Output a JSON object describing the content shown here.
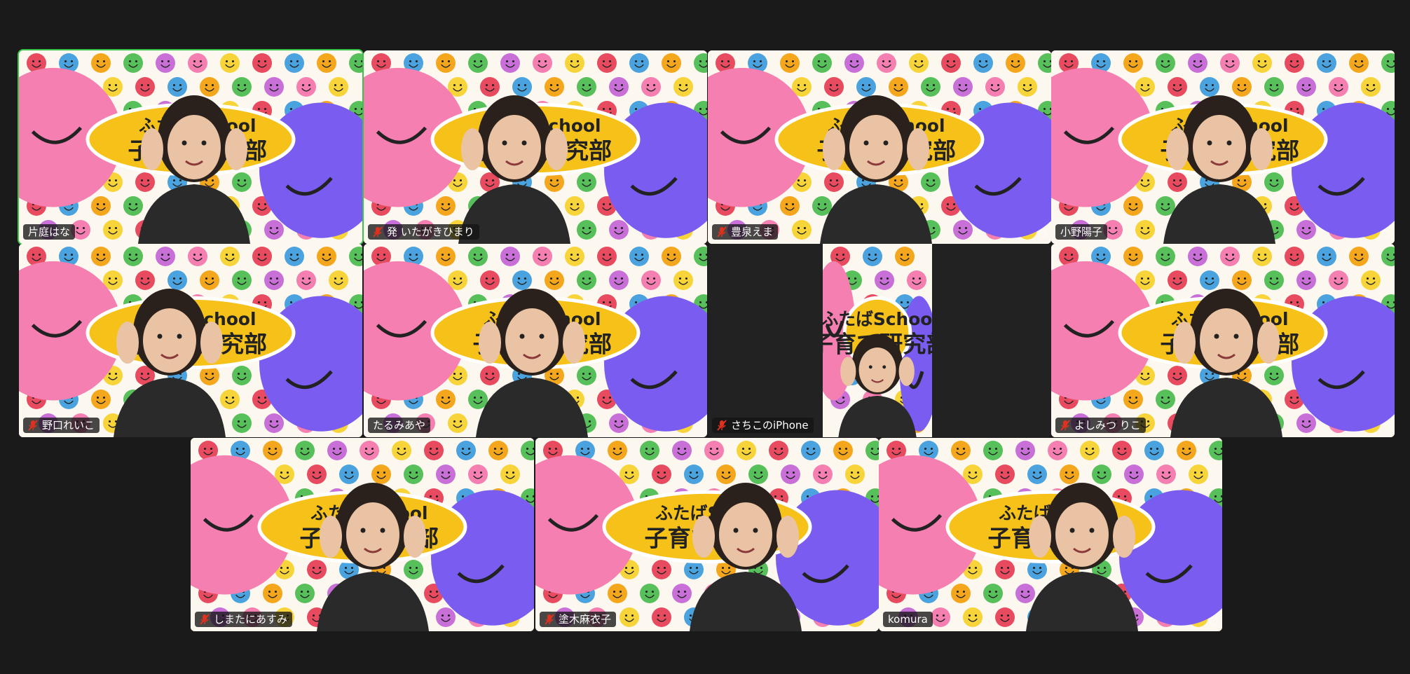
{
  "participants": [
    {
      "name": "片庭はな",
      "muted": false,
      "active_speaker": true
    },
    {
      "name": "発 いたがきひまり",
      "muted": true,
      "active_speaker": false
    },
    {
      "name": "豊泉えま",
      "muted": true,
      "active_speaker": false
    },
    {
      "name": "小野陽子",
      "muted": false,
      "active_speaker": false
    },
    {
      "name": "野口れいこ",
      "muted": true,
      "active_speaker": false
    },
    {
      "name": "たるみあや",
      "muted": false,
      "active_speaker": false
    },
    {
      "name": "さちこのiPhone",
      "muted": true,
      "active_speaker": false
    },
    {
      "name": "よしみつ りこ",
      "muted": true,
      "active_speaker": false
    },
    {
      "name": "しまたにあすみ",
      "muted": true,
      "active_speaker": false
    },
    {
      "name": "塗木麻衣子",
      "muted": true,
      "active_speaker": false
    },
    {
      "name": "komura",
      "muted": false,
      "active_speaker": false
    }
  ],
  "background_banner": {
    "line1": "ふたばSchool",
    "line2": "子育て研究部"
  },
  "colors": {
    "window_bg": "#1a1a1a",
    "active_speaker_border": "#3bc24a",
    "banner_yellow": "#f6c21a",
    "blob_pink": "#f47fb0",
    "blob_purple": "#7b5cf0",
    "mute_red": "#e0301e"
  }
}
